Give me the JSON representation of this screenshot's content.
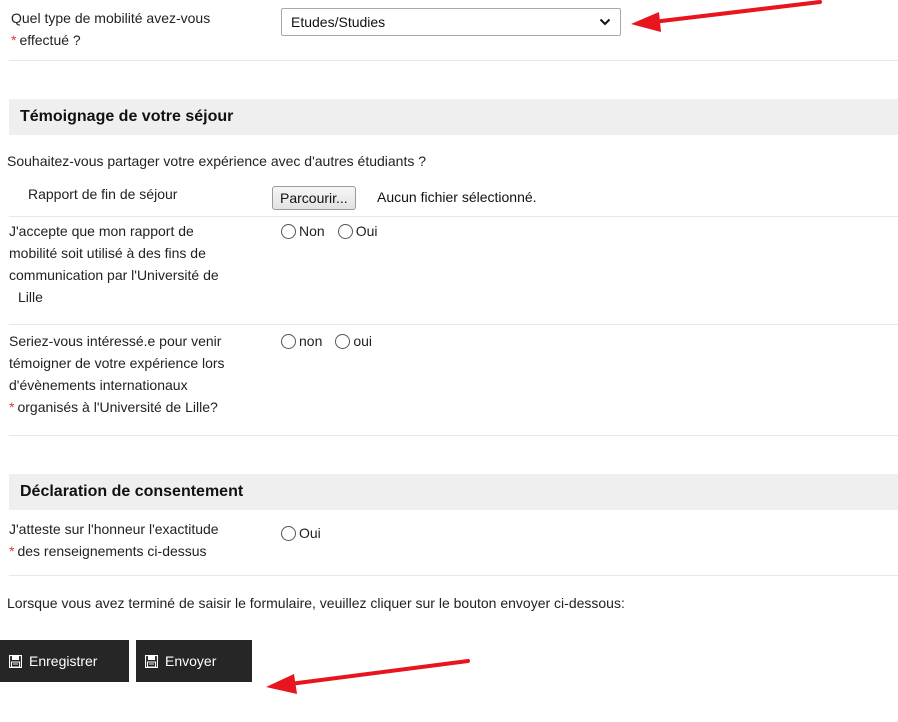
{
  "mobility": {
    "label_line1": "Quel type de mobilité avez-vous",
    "label_line2": "effectué ?",
    "required_mark": "*",
    "selected_value": "Etudes/Studies",
    "chevron_icon": "chevron-down-icon"
  },
  "testimony": {
    "heading": "Témoignage de votre séjour",
    "intro": "Souhaitez-vous partager votre expérience avec d'autres étudiants ?",
    "report": {
      "label": "Rapport de fin de séjour",
      "browse_label": "Parcourir...",
      "file_status": "Aucun fichier sélectionné."
    },
    "consent_use": {
      "label_lines": [
        "J'accepte que mon rapport de",
        "mobilité soit utilisé à des fins de",
        "communication par l'Université de",
        "Lille"
      ],
      "options": [
        "Non",
        "Oui"
      ]
    },
    "events": {
      "label_lines": [
        "Seriez-vous intéressé.e pour venir",
        "témoigner de votre expérience lors",
        "d'évènements internationaux",
        "organisés à l'Université de Lille?"
      ],
      "required_mark": "*",
      "options": [
        "non",
        "oui"
      ]
    }
  },
  "declaration": {
    "heading": "Déclaration de consentement",
    "label_line1": "J'atteste sur l'honneur l'exactitude",
    "label_line2": "des renseignements ci-dessus",
    "required_mark": "*",
    "option": "Oui"
  },
  "footer": {
    "instruction": "Lorsque vous avez terminé de saisir le formulaire, veuillez cliquer sur le bouton envoyer ci-dessous:",
    "save_label": "Enregistrer",
    "send_label": "Envoyer",
    "button_icon": "floppy-disk-icon"
  },
  "colors": {
    "required": "#e03a3a",
    "annotation_arrow": "#e8141e",
    "button_bg": "#262626",
    "section_bg": "#efefef"
  }
}
